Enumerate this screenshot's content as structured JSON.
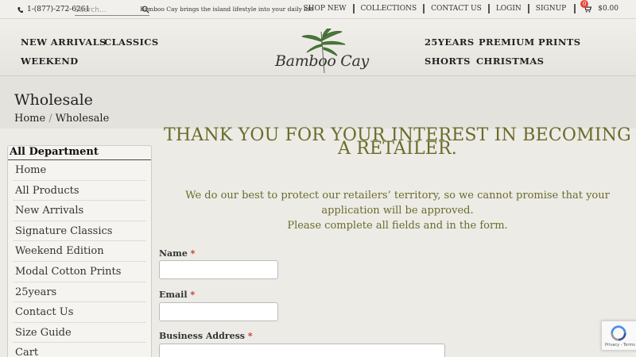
{
  "topbar": {
    "phone": "1-(877)-272-6261",
    "search_placeholder": "Search...",
    "tagline": "Bamboo Cay brings the island lifestyle into your daily life",
    "links": [
      "SHOP NEW",
      "COLLECTIONS",
      "CONTACT US",
      "LOGIN",
      "SIGNUP"
    ],
    "cart_count": "0",
    "cart_total": "$0.00"
  },
  "header": {
    "nav_left": [
      "NEW ARRIVALS",
      "CLASSICS",
      "WEEKEND"
    ],
    "nav_right": [
      "25YEARS",
      "PREMIUM PRINTS",
      "SHORTS",
      "CHRISTMAS"
    ],
    "logo_text": "Bamboo Cay"
  },
  "titleband": {
    "title": "Wholesale",
    "breadcrumb": [
      "Home",
      "Wholesale"
    ]
  },
  "sidebar": {
    "heading": "All Department",
    "items": [
      "Home",
      "All Products",
      "New Arrivals",
      "Signature Classics",
      "Weekend Edition",
      "Modal Cotton Prints",
      "25years",
      "Contact Us",
      "Size Guide",
      "Cart"
    ]
  },
  "main": {
    "heading": "THANK YOU FOR YOUR INTEREST IN BECOMING A RETAILER.",
    "intro_line1": "We do our best to protect our retailers’ territory, so we cannot promise that your application will be approved.",
    "intro_line2": "Please complete all fields and in the form.",
    "fields": [
      {
        "label": "Name",
        "required": "*",
        "value": ""
      },
      {
        "label": "Email",
        "required": "*",
        "value": ""
      },
      {
        "label": "Business Address",
        "required": "*",
        "value": ""
      }
    ]
  },
  "recaptcha": {
    "text": "Privacy - Terms"
  },
  "colors": {
    "accent_text": "#6b6b2a",
    "required": "#c0392b",
    "badge": "#e8453c",
    "page_bg": "#ecebe6"
  }
}
